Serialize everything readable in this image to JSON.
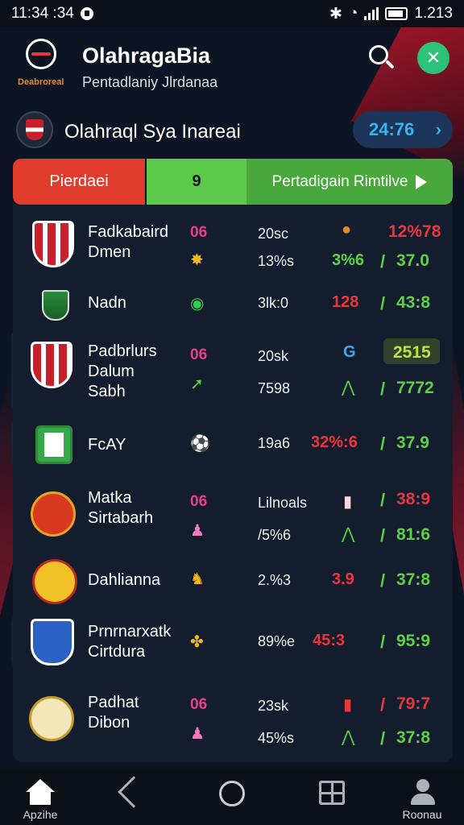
{
  "status_bar": {
    "time": "11:34 :34",
    "right_text": "1.213"
  },
  "header": {
    "logo_text": "Deabroreal",
    "title": "OlahragaBia",
    "subtitle": "Pentadlaniy Jlrdanaa"
  },
  "account": {
    "name": "Olahraql Sya Inareai",
    "pill_value": "24:76"
  },
  "tabs": {
    "left_label": "Pierdaei",
    "count": "9",
    "right_label": "Pertadigain Rimtilve"
  },
  "rows": [
    {
      "name_lines": [
        "Fadkabaird",
        "Dmen"
      ],
      "code": "06",
      "val1": "20sc",
      "val2": "13%s",
      "mid1": "",
      "mid2": "3%6",
      "odd1": "12%78",
      "odd2": "37.0",
      "odd1_prefix": ""
    },
    {
      "name_lines": [
        "Nadn"
      ],
      "code": "",
      "val1": "3lk:0",
      "mid1": "128",
      "odd1": "43:8"
    },
    {
      "name_lines": [
        "Padbrlurs",
        "Dalum",
        "Sabh"
      ],
      "code": "06",
      "val1": "20sk",
      "val2": "7598",
      "mid1": "G",
      "odd1": "2515",
      "odd2": "7772"
    },
    {
      "name_lines": [
        "FcAY"
      ],
      "code": "",
      "val1": "19a6",
      "mid1": "32%:6",
      "odd1": "37.9"
    },
    {
      "name_lines": [
        "Matka",
        "Sirtabarh"
      ],
      "code": "06",
      "val1": "Lilnoals",
      "val2": "/5%6",
      "odd1": "38:9",
      "odd2": "81:6"
    },
    {
      "name_lines": [
        "Dahlianna"
      ],
      "code": "",
      "val1": "2.%3",
      "mid1": "3.9",
      "odd1": "37:8"
    },
    {
      "name_lines": [
        "Prnrnarxatk",
        "Cirtdura"
      ],
      "code": "",
      "val1": "89%e",
      "mid1": "45:3",
      "odd1": "95:9"
    },
    {
      "name_lines": [
        "Padhat",
        "Dibon"
      ],
      "code": "06",
      "val1": "23sk",
      "val2": "45%s",
      "odd1": "79:7",
      "odd2": "37:8"
    }
  ],
  "bottom_nav": {
    "home_label": "Apzihe",
    "profile_label": "Roonau"
  },
  "colors": {
    "accent_red": "#e03b2c",
    "accent_green": "#5cc94b",
    "odds_green": "#5bd23f",
    "code_pink": "#ee3a8c",
    "background": "#0d1524"
  },
  "icons": [
    "search-icon",
    "user-badge-icon",
    "home-icon",
    "back-icon",
    "circle-icon",
    "grid-icon",
    "profile-icon"
  ]
}
